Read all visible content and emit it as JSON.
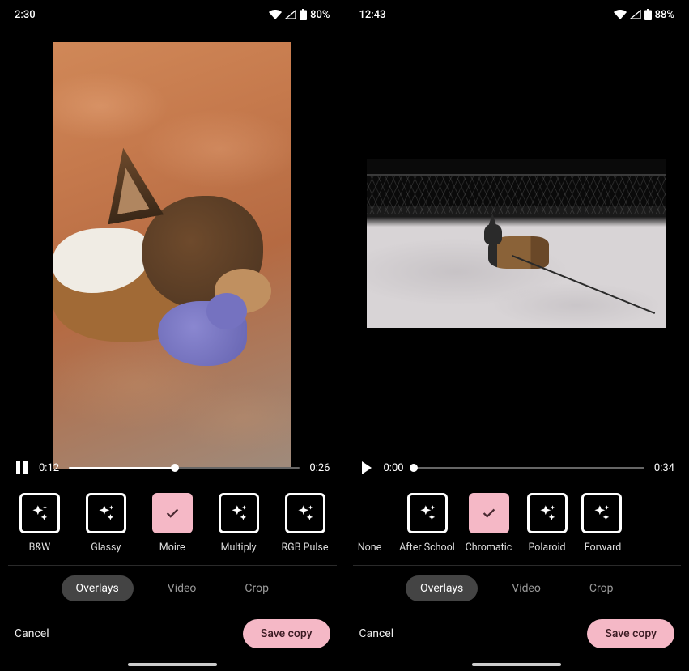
{
  "phones": [
    {
      "status": {
        "time": "2:30",
        "battery": "80%"
      },
      "player": {
        "icon": "pause",
        "current": "0:12",
        "total": "0:26",
        "progress": 0.46
      },
      "filters": [
        {
          "label": "B&W",
          "selected": false
        },
        {
          "label": "Glassy",
          "selected": false
        },
        {
          "label": "Moire",
          "selected": true
        },
        {
          "label": "Multiply",
          "selected": false
        },
        {
          "label": "RGB Pulse",
          "selected": false
        }
      ],
      "tabs": {
        "overlays": "Overlays",
        "video": "Video",
        "crop": "Crop",
        "active": "overlays"
      },
      "actions": {
        "cancel": "Cancel",
        "save": "Save copy"
      }
    },
    {
      "status": {
        "time": "12:43",
        "battery": "88%"
      },
      "player": {
        "icon": "play",
        "current": "0:00",
        "total": "0:34",
        "progress": 0.0
      },
      "filters": [
        {
          "label": "None",
          "selected": false,
          "none": true
        },
        {
          "label": "After School",
          "selected": false
        },
        {
          "label": "Chromatic",
          "selected": true
        },
        {
          "label": "Polaroid",
          "selected": false
        },
        {
          "label": "Forward",
          "selected": false,
          "partial": true
        }
      ],
      "tabs": {
        "overlays": "Overlays",
        "video": "Video",
        "crop": "Crop",
        "active": "overlays"
      },
      "actions": {
        "cancel": "Cancel",
        "save": "Save copy"
      }
    }
  ],
  "colors": {
    "accent": "#f5b8c6"
  }
}
